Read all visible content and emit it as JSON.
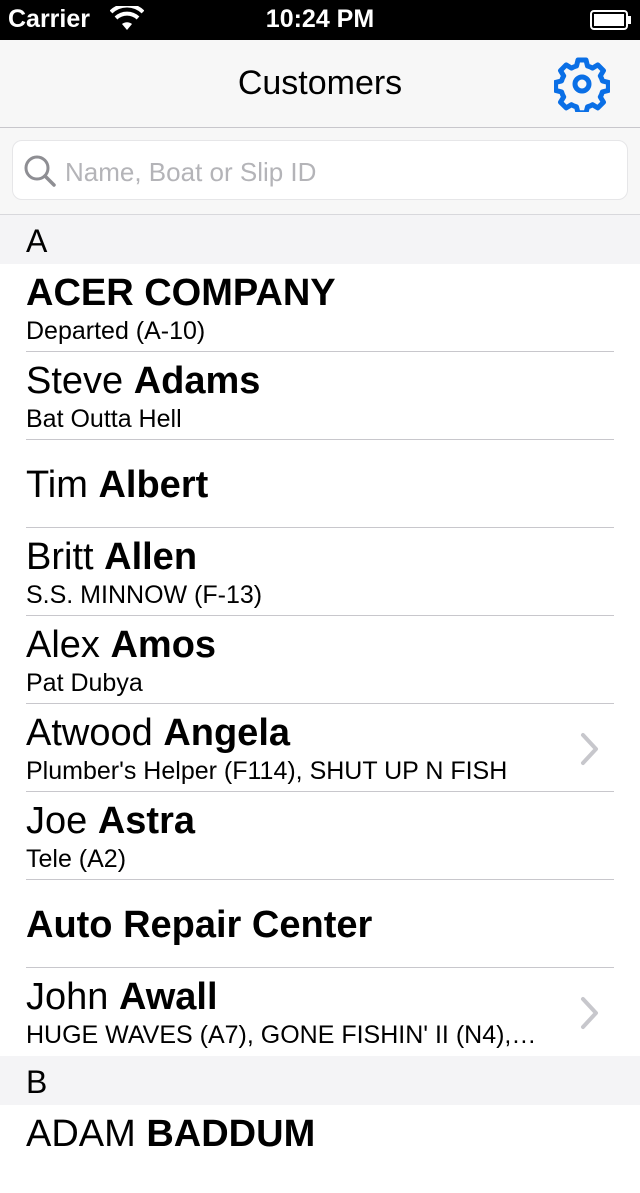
{
  "status_bar": {
    "carrier": "Carrier",
    "time": "10:24 PM"
  },
  "nav": {
    "title": "Customers",
    "settings_icon": "gear-icon"
  },
  "search": {
    "placeholder": "Name, Boat or Slip ID",
    "value": ""
  },
  "sections": [
    {
      "letter": "A",
      "rows": [
        {
          "first": "",
          "last": "ACER COMPANY",
          "detail": "Departed (A-10)",
          "chevron": false
        },
        {
          "first": "Steve",
          "last": "Adams",
          "detail": "Bat Outta Hell",
          "chevron": false
        },
        {
          "first": "Tim",
          "last": "Albert",
          "detail": "",
          "chevron": false
        },
        {
          "first": "Britt",
          "last": "Allen",
          "detail": "S.S. MINNOW (F-13)",
          "chevron": false
        },
        {
          "first": "Alex",
          "last": "Amos",
          "detail": "Pat Dubya",
          "chevron": false
        },
        {
          "first": "Atwood",
          "last": "Angela",
          "detail": "Plumber's Helper (F114), SHUT UP N FISH",
          "chevron": true
        },
        {
          "first": "Joe",
          "last": "Astra",
          "detail": "Tele (A2)",
          "chevron": false
        },
        {
          "first": "",
          "last": "Auto Repair Center",
          "detail": "",
          "chevron": false
        },
        {
          "first": "John",
          "last": "Awall",
          "detail": "HUGE WAVES (A7), GONE FISHIN' II (N4),…",
          "chevron": true
        }
      ]
    },
    {
      "letter": "B",
      "rows": [
        {
          "first": "ADAM",
          "last": "BADDUM",
          "detail": "",
          "chevron": false
        }
      ]
    }
  ],
  "colors": {
    "accent": "#0a6fe6",
    "separator": "#c8c7cc",
    "section_bg": "#f4f4f6"
  }
}
